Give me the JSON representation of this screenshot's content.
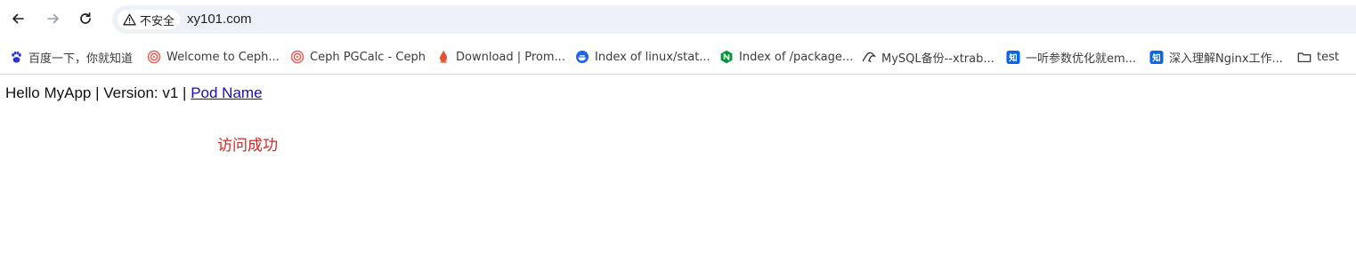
{
  "toolbar": {
    "back_icon": "arrow-left-icon",
    "forward_icon": "arrow-right-icon",
    "reload_icon": "reload-icon",
    "security_label": "不安全",
    "url": "xy101.com"
  },
  "bookmarks": [
    {
      "label": "百度一下，你就知道",
      "icon": "baidu-icon",
      "color": "#2932e1"
    },
    {
      "label": "Welcome to Ceph...",
      "icon": "ceph-icon",
      "color": "#ef5c55"
    },
    {
      "label": "Ceph PGCalc - Ceph",
      "icon": "ceph-icon",
      "color": "#ef5c55"
    },
    {
      "label": "Download | Prom...",
      "icon": "prometheus-icon",
      "color": "#e6522c"
    },
    {
      "label": "Index of linux/stat...",
      "icon": "docker-icon",
      "color": "#1d63ed"
    },
    {
      "label": "Index of /package...",
      "icon": "nginx-icon",
      "color": "#009639"
    },
    {
      "label": "MySQL备份--xtrab...",
      "icon": "mysql-icon",
      "color": "#333333"
    },
    {
      "label": "一听参数优化就em...",
      "icon": "zhihu-icon",
      "color": "#0a66e6"
    },
    {
      "label": "深入理解Nginx工作...",
      "icon": "zhihu-icon",
      "color": "#0a66e6"
    },
    {
      "label": "test",
      "icon": "folder-icon",
      "color": "#3c3c3c"
    }
  ],
  "page": {
    "hello_text": "Hello MyApp | Version: v1 | ",
    "pod_link": "Pod Name",
    "success_text": "访问成功",
    "link_color": "#1a0dab",
    "success_color": "#e02020"
  }
}
